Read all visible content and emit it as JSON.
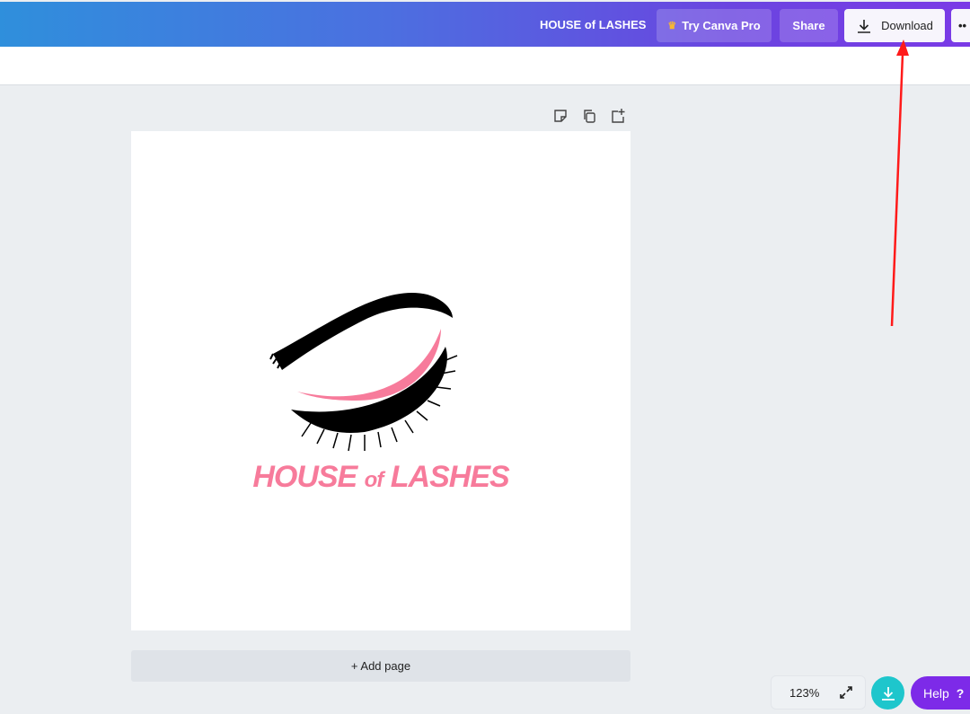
{
  "header": {
    "design_title": "HOUSE of LASHES",
    "try_pro_label": "Try Canva Pro",
    "share_label": "Share",
    "download_label": "Download",
    "more_label": "••"
  },
  "canvas": {
    "logo_text": {
      "part1": "HOUSE ",
      "part2": "of",
      "part3": " LASHES"
    },
    "add_page_label": "+ Add page"
  },
  "footer": {
    "zoom_level": "123%",
    "help_label": "Help",
    "help_icon": "?"
  },
  "colors": {
    "accent": "#7d2ae8",
    "logo_pink": "#f77b9b",
    "teal": "#1ec6cc",
    "annotation_arrow": "#ff1a1a"
  }
}
